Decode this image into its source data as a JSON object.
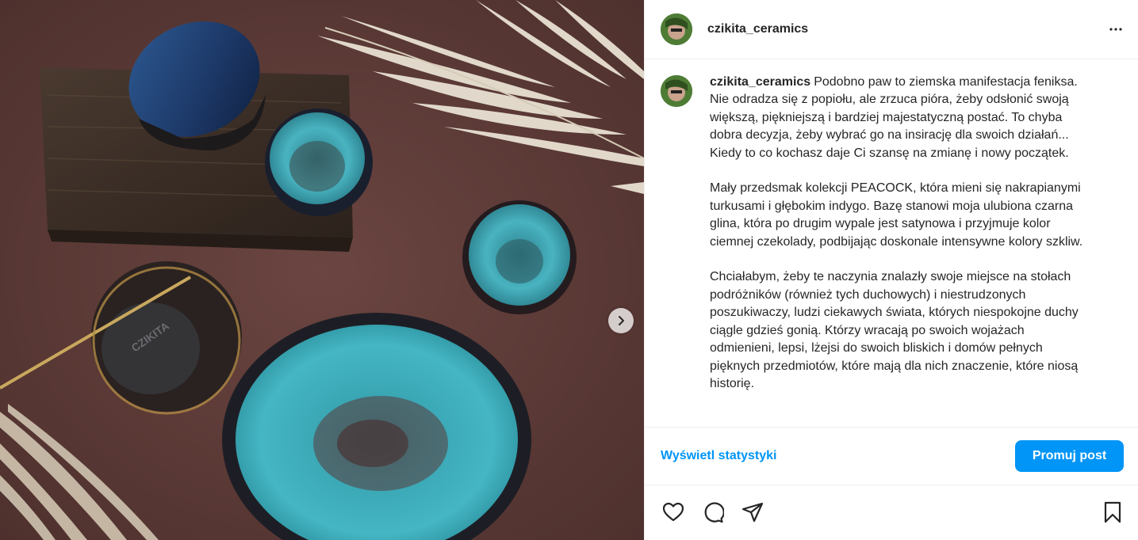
{
  "post": {
    "author": {
      "username": "czikita_ceramics",
      "avatar_icon": "profile-avatar"
    },
    "media": {
      "next_icon": "chevron-right-icon",
      "description_colors": {
        "background": "#5e3a37",
        "turquoise": "#3fb0bf",
        "indigo": "#1e3a6e"
      }
    },
    "caption": {
      "username": "czikita_ceramics",
      "paragraphs": [
        "Podobno paw to ziemska manifestacja feniksa. Nie odradza się z popiołu, ale zrzuca pióra, żeby odsłonić swoją większą, piękniejszą i bardziej majestatyczną postać. To chyba dobra decyzja, żeby wybrać go na insirację dla swoich działań... Kiedy to co kochasz daje Ci szansę na zmianę i nowy początek.",
        "Mały przedsmak kolekcji PEACOCK, która mieni się nakrapianymi turkusami i głębokim indygo. Bazę stanowi moja ulubiona czarna glina, która po drugim wypale jest satynowa i przyjmuje kolor ciemnej czekolady, podbijając doskonale intensywne kolory szkliw.",
        "Chciałabym, żeby te naczynia znalazły swoje miejsce na stołach podróżników (również tych duchowych) i niestrudzonych poszukiwaczy, ludzi ciekawych świata, których niespokojne duchy ciągle gdzieś gonią. Którzy wracają po swoich wojażach odmienieni, lepsi, lżejsi do swoich bliskich i domów pełnych pięknych przedmiotów, które mają dla nich znaczenie, które niosą historię."
      ]
    },
    "stats_link": "Wyświetl statystyki",
    "promote_button": "Promuj post",
    "actions": {
      "like_icon": "heart-icon",
      "comment_icon": "comment-icon",
      "share_icon": "share-icon",
      "save_icon": "bookmark-icon",
      "more_icon": "more-options-icon"
    },
    "colors": {
      "accent": "#0095f6",
      "text": "#262626",
      "divider": "#efefef"
    }
  }
}
